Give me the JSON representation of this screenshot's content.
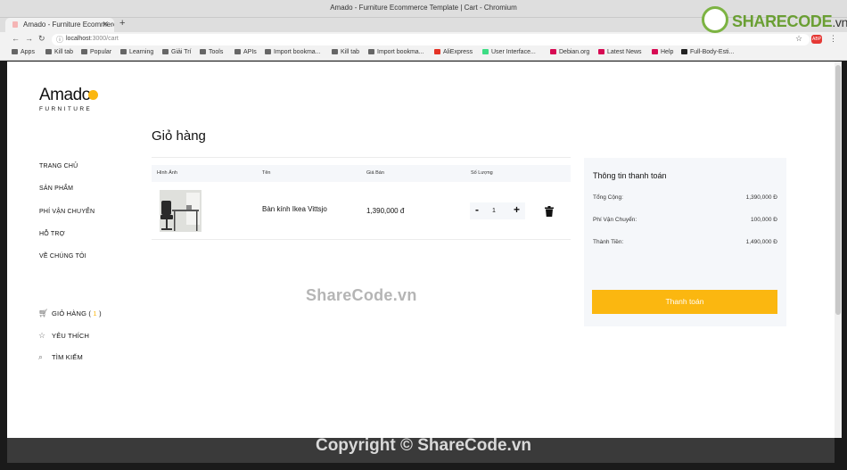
{
  "browser": {
    "window_title": "Amado - Furniture Ecommerce Template | Cart - Chromium",
    "tab_title": "Amado - Furniture Ecommerce",
    "url_host": "localhost",
    "url_path": ":3000/cart",
    "bookmarks": [
      "Apps",
      "Kill tab",
      "Popular",
      "Learning",
      "Giải Trí",
      "Tools",
      "APIs",
      "Import bookma...",
      "Kill tab",
      "Import bookma...",
      "AliExpress",
      "User Interface...",
      "Debian.org",
      "Latest News",
      "Help",
      "Full-Body-Esti..."
    ]
  },
  "logo": {
    "name": "Amado",
    "sub": "FURNITURE"
  },
  "sidebar": {
    "nav": [
      "TRANG CHỦ",
      "SẢN PHẨM",
      "PHÍ VẬN CHUYỂN",
      "HỖ TRỢ",
      "VỀ CHÚNG TÔI"
    ],
    "cart_label": "GIỎ HÀNG (",
    "cart_count": "1",
    "cart_close": ")",
    "favorites": "YÊU THÍCH",
    "search": "TÌM KIẾM"
  },
  "cart": {
    "heading": "Giỏ hàng",
    "columns": [
      "Hình Ảnh",
      "Tên",
      "Giá Bán",
      "Số Lượng"
    ],
    "items": [
      {
        "name": "Bàn kính Ikea Vittsjo",
        "price": "1,390,000 đ",
        "quantity": "1"
      }
    ]
  },
  "summary": {
    "title": "Thông tin thanh toán",
    "rows": [
      {
        "label": "Tổng Cộng:",
        "value": "1,390,000 Đ"
      },
      {
        "label": "Phí Vận Chuyển:",
        "value": "100,000 Đ"
      },
      {
        "label": "Thành Tiền:",
        "value": "1,490,000 Đ"
      }
    ],
    "checkout_label": "Thanh toán"
  },
  "watermarks": {
    "middle": "ShareCode.vn",
    "bottom": "Copyright © ShareCode.vn",
    "brand": "SHARECODE",
    "brand_tld": ".vn"
  },
  "colors": {
    "accent": "#fbb710",
    "table_header_bg": "#f5f7fa"
  }
}
